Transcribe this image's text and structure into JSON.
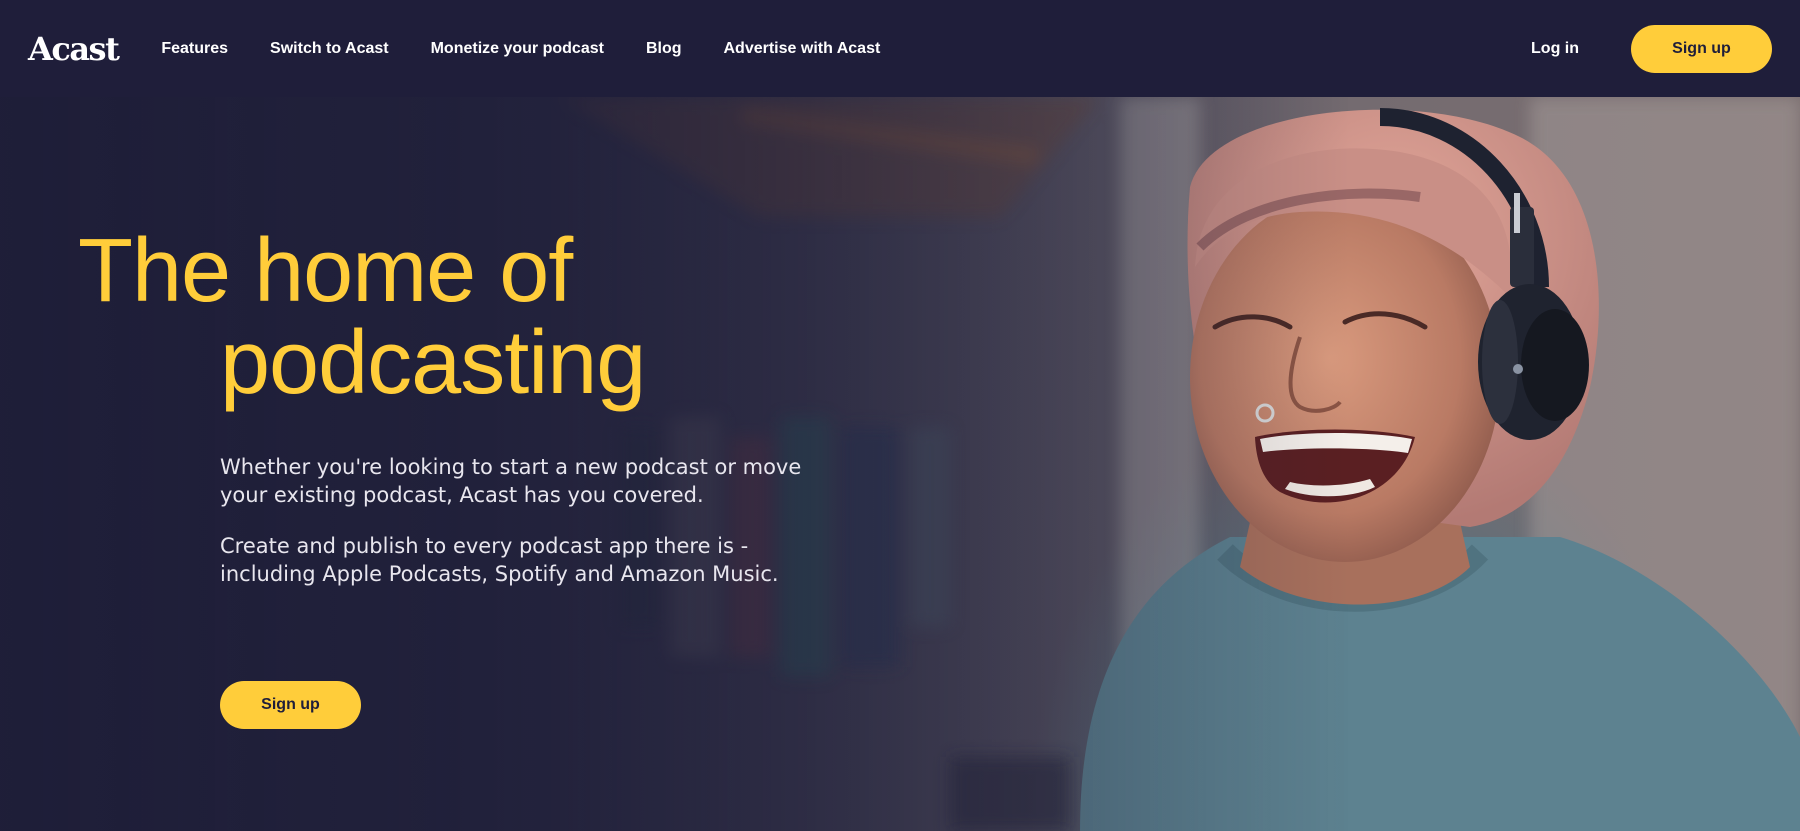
{
  "nav": {
    "logo": "Acast",
    "links": [
      "Features",
      "Switch to Acast",
      "Monetize your podcast",
      "Blog",
      "Advertise with Acast"
    ],
    "login": "Log in",
    "signup": "Sign up"
  },
  "hero": {
    "title_line1": "The home of",
    "title_line2": "podcasting",
    "paragraph1": "Whether you're looking to start a new podcast or move your existing podcast, Acast has you covered.",
    "paragraph2": "Create and publish to every podcast app there is - including Apple Podcasts, Spotify and Amazon Music.",
    "cta": "Sign up",
    "image_subject": "woman-with-headphones-laughing"
  },
  "colors": {
    "nav_bg": "#1f1e3a",
    "accent": "#ffcd3a",
    "text_light": "#e8e6ee"
  }
}
